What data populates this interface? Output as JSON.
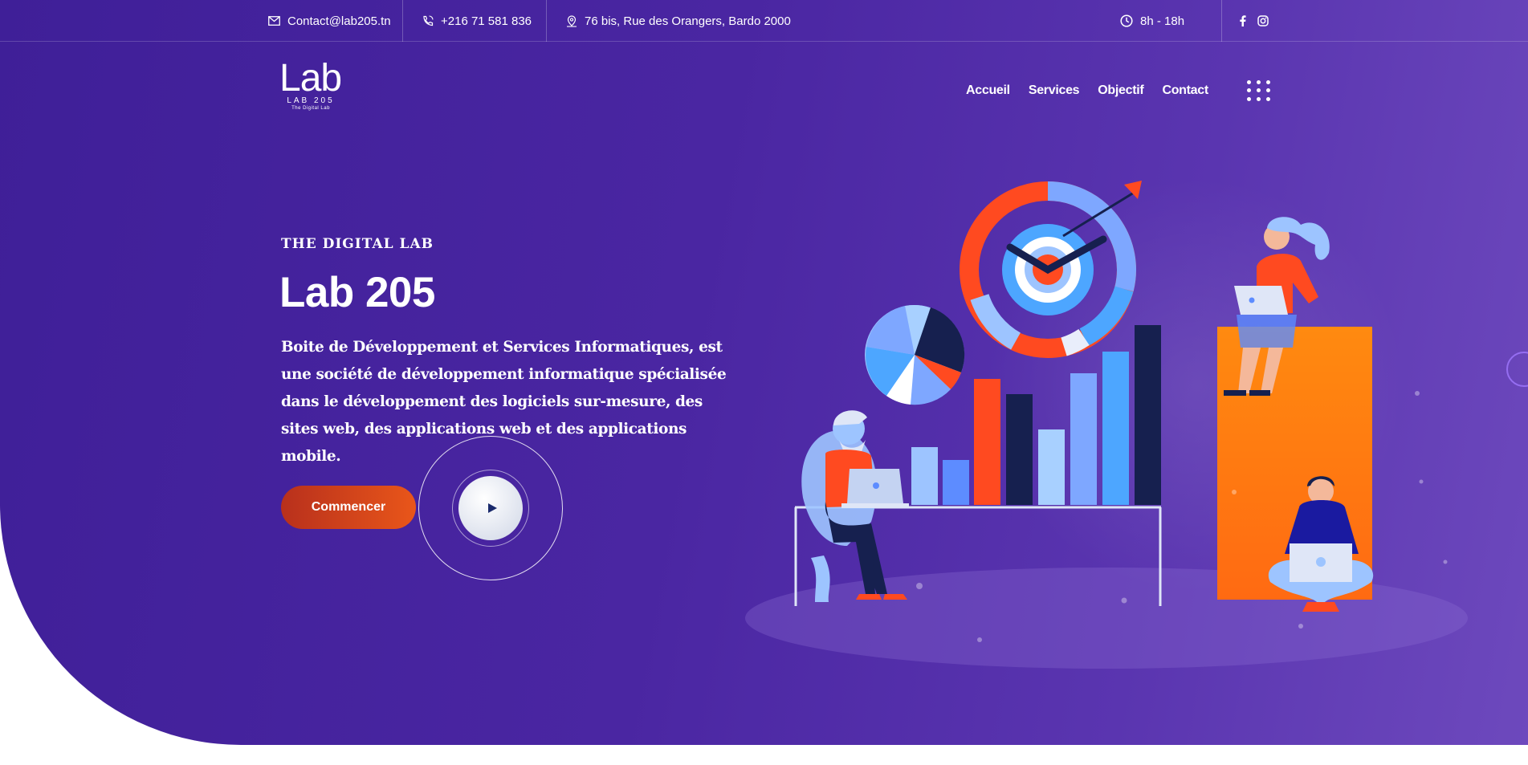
{
  "topbar": {
    "email": "Contact@lab205.tn",
    "phone": "+216 71 581 836",
    "address": "76 bis, Rue des Orangers, Bardo 2000",
    "hours": "8h - 18h",
    "social": [
      "facebook-icon",
      "instagram-icon"
    ]
  },
  "logo": {
    "text": "Lab",
    "sub": "LAB 205",
    "tagline": "The Digital Lab"
  },
  "nav": {
    "items": [
      "Accueil",
      "Services",
      "Objectif",
      "Contact"
    ]
  },
  "hero": {
    "eyebrow": "THE DIGITAL LAB",
    "title": "Lab 205",
    "description": "Boite de Développement et Services Informatiques, est une société de développement informatique spécialisée dans le développement des logiciels sur-mesure, des sites web, des applications web et des applications mobile.",
    "cta_label": "Commencer"
  },
  "colors": {
    "hero_start": "#3f1f98",
    "hero_end": "#6d49bd",
    "cta_start": "#b8301c",
    "cta_end": "#e9561a",
    "accent_orange": "#ff7a10",
    "accent_red": "#ff4a20"
  }
}
